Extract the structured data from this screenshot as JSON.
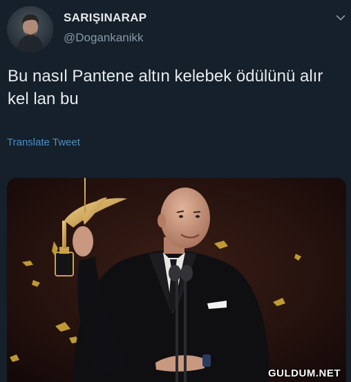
{
  "tweet": {
    "display_name": "SARIŞINARAP",
    "handle": "@Dogankanikk",
    "text": "Bu nasıl Pantene altın kelebek ödülünü alır kel lan bu",
    "translate_label": "Translate Tweet"
  },
  "media": {
    "watermark": "GULDUM.NET"
  },
  "colors": {
    "background": "#15202b",
    "text": "#e8eaed",
    "secondary": "#8899a6",
    "link": "#4c8fc4"
  },
  "icons": {
    "caret": "chevron-down-icon"
  }
}
